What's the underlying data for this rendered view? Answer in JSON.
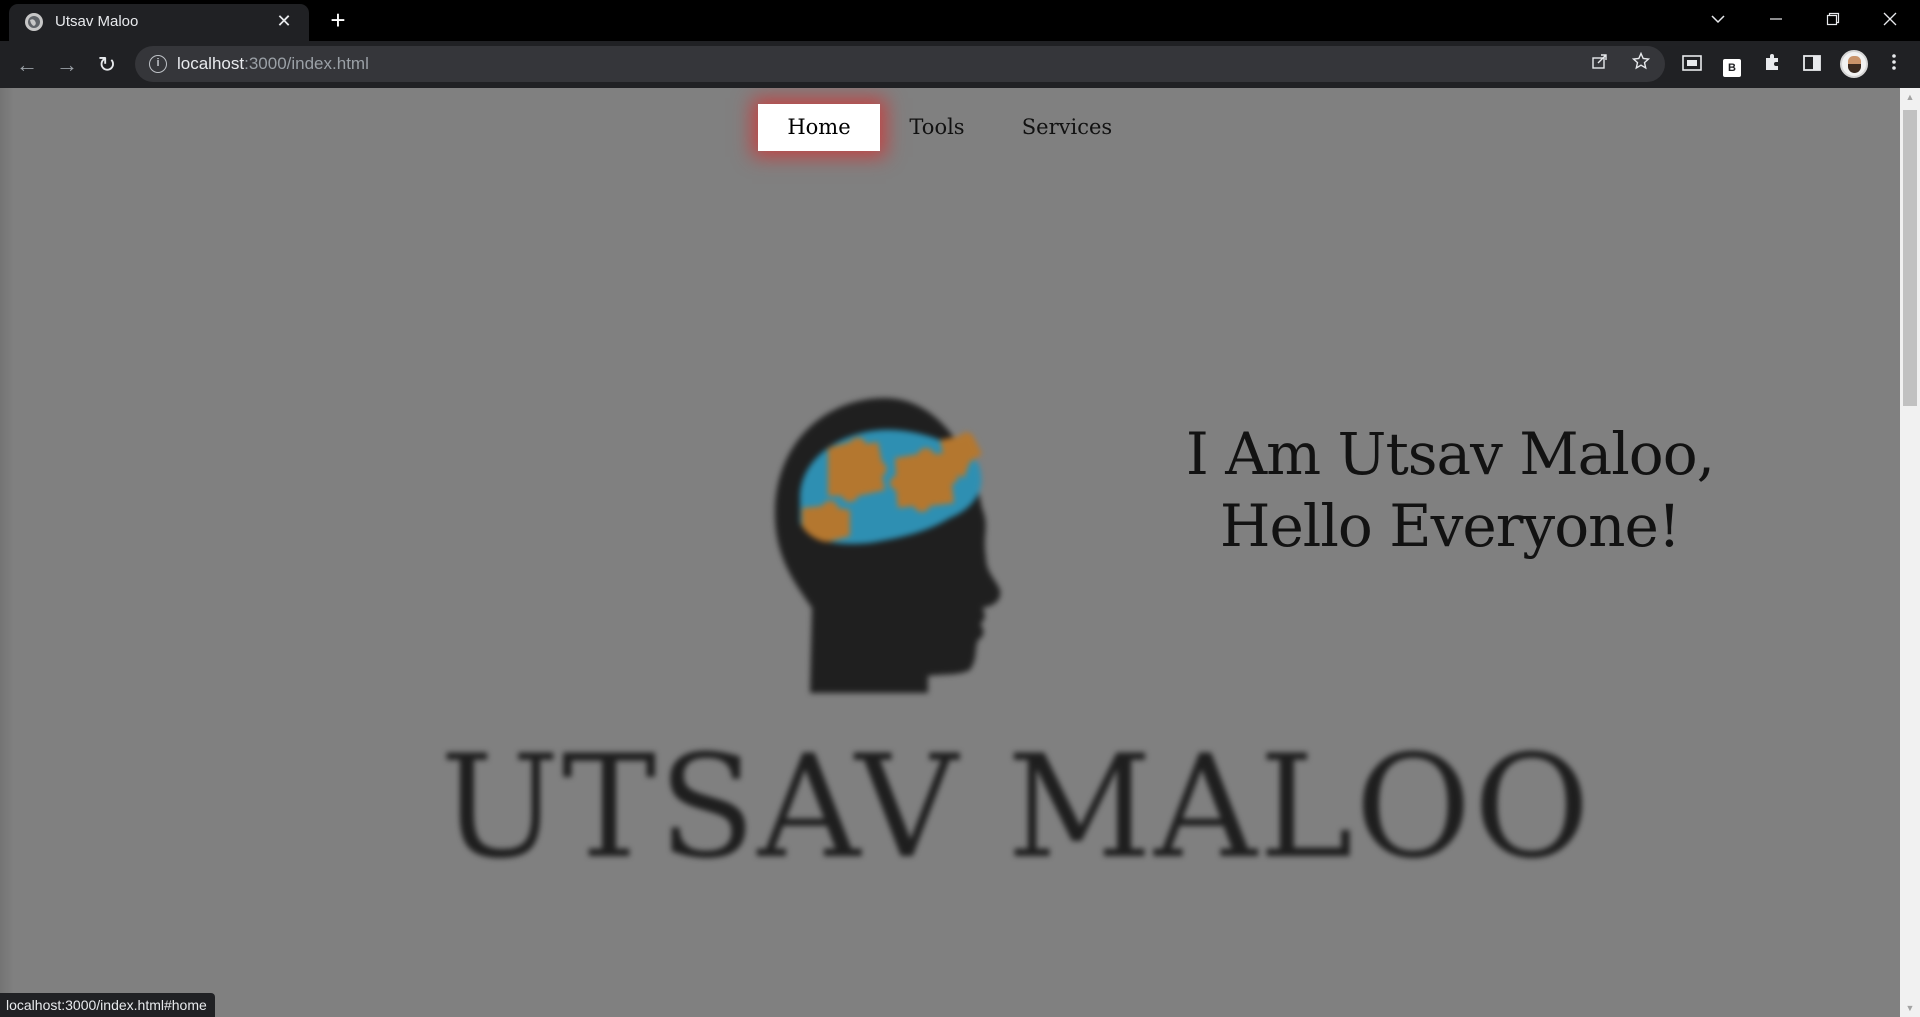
{
  "browser": {
    "tab_title": "Utsav Maloo",
    "tab_close": "✕",
    "new_tab": "+",
    "url_host": "localhost",
    "url_rest": ":3000/index.html",
    "extension_badge": "B",
    "window_controls": {
      "tab_search": "⌵",
      "minimize": "—",
      "restore": "❐",
      "close": "✕"
    },
    "nav": {
      "back": "←",
      "forward": "→",
      "reload": "↻"
    },
    "status_url": "localhost:3000/index.html#home"
  },
  "page": {
    "nav": {
      "items": [
        "Home",
        "Tools",
        "Services"
      ],
      "active": "Home"
    },
    "hero": {
      "line1": "I Am Utsav Maloo,",
      "line2": "Hello Everyone!"
    },
    "logo": {
      "wordmark": "UTSAV MALOO",
      "colors": {
        "head": "#1f1f1f",
        "puzzle_blue": "#2e8fb2",
        "puzzle_orange": "#b4772f"
      }
    }
  },
  "colors": {
    "page_background": "#808080",
    "active_nav_glow": "#d63030",
    "chrome_dark": "#202124"
  }
}
